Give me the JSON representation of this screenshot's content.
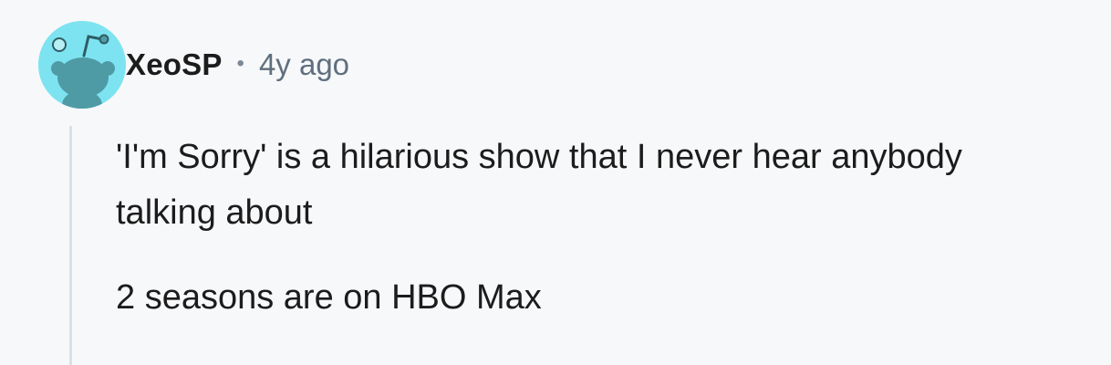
{
  "comment": {
    "author": "XeoSP",
    "separator": "•",
    "timestamp": "4y ago",
    "avatar_icon": "reddit-snoo-avatar-icon",
    "avatar_bg_color": "#7ee3f1",
    "paragraphs": [
      "'I'm Sorry' is a hilarious show that I never hear anybody talking about",
      "2 seasons are on HBO Max"
    ]
  }
}
